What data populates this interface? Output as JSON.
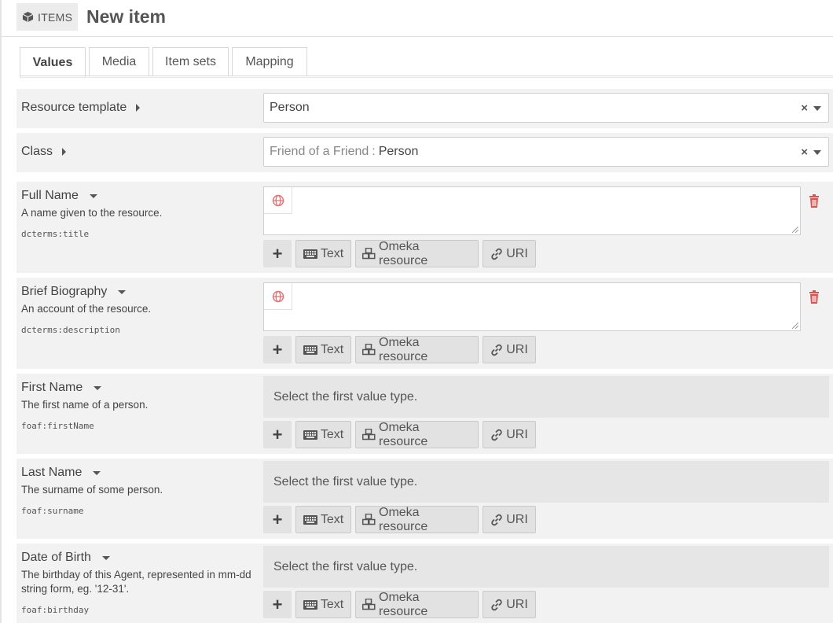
{
  "header": {
    "section_label": "ITEMS",
    "section_icon": "cube-icon",
    "title": "New item"
  },
  "tabs": [
    {
      "label": "Values",
      "active": true
    },
    {
      "label": "Media",
      "active": false
    },
    {
      "label": "Item sets",
      "active": false
    },
    {
      "label": "Mapping",
      "active": false
    }
  ],
  "resource_template": {
    "label": "Resource template",
    "value": "Person",
    "clear": "×"
  },
  "class": {
    "label": "Class",
    "vocab": "Friend of a Friend",
    "separator": ":",
    "value": "Person",
    "clear": "×"
  },
  "value_buttons": {
    "add": "+",
    "text": "Text",
    "resource": "Omeka resource",
    "uri": "URI"
  },
  "properties": [
    {
      "label": "Full Name",
      "description": "A name given to the resource.",
      "term": "dcterms:title",
      "value": ""
    },
    {
      "label": "Brief Biography",
      "description": "An account of the resource.",
      "term": "dcterms:description",
      "value": ""
    },
    {
      "label": "First Name",
      "description": "The first name of a person.",
      "term": "foaf:firstName",
      "placeholder": "Select the first value type."
    },
    {
      "label": "Last Name",
      "description": "The surname of some person.",
      "term": "foaf:surname",
      "placeholder": "Select the first value type."
    },
    {
      "label": "Date of Birth",
      "description": "The birthday of this Agent, represented in mm-dd string form, eg. '12-31'.",
      "term": "foaf:birthday",
      "placeholder": "Select the first value type."
    }
  ],
  "colors": {
    "panel": "#f2f2f2",
    "button": "#e2e2e2",
    "trash": "#d9534f",
    "globe": "#e57373"
  }
}
